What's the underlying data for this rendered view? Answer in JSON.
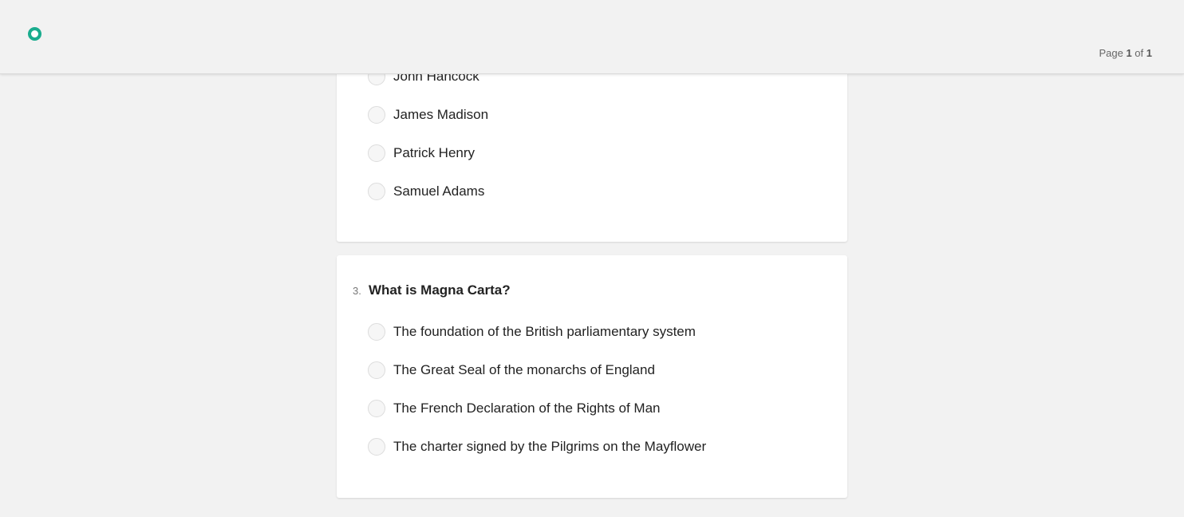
{
  "header": {
    "brand_color": "#1aac8e",
    "logo_icon": "ring-logo-icon",
    "page_prefix": "Page",
    "page_current": "1",
    "page_of": "of",
    "page_total": "1"
  },
  "questions": [
    {
      "number": "",
      "text": "",
      "options": [
        "John Hancock",
        "James Madison",
        "Patrick Henry",
        "Samuel Adams"
      ]
    },
    {
      "number": "3.",
      "text": "What is Magna Carta?",
      "options": [
        "The foundation of the British parliamentary system",
        "The Great Seal of the monarchs of England",
        "The French Declaration of the Rights of Man",
        "The charter signed by the Pilgrims on the Mayflower"
      ]
    }
  ]
}
